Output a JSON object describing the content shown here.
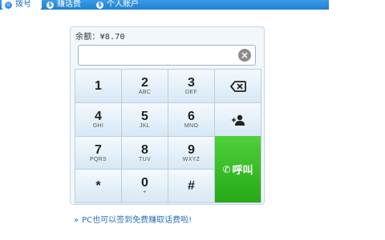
{
  "nav": {
    "items": [
      {
        "label": "拨号",
        "icon": "phone-icon",
        "active": true
      },
      {
        "label": "赚话费",
        "icon": "coin-icon",
        "active": false
      },
      {
        "label": "个人账户",
        "icon": "dollar-icon",
        "active": false
      }
    ],
    "accent": "#1f7fd2"
  },
  "balance_text": "余额：¥8.70",
  "dial_input": {
    "value": "",
    "placeholder": ""
  },
  "keys": [
    {
      "digit": "1",
      "letters": ""
    },
    {
      "digit": "2",
      "letters": "ABC"
    },
    {
      "digit": "3",
      "letters": "DEF"
    },
    {
      "digit": "4",
      "letters": "GHI"
    },
    {
      "digit": "5",
      "letters": "JKL"
    },
    {
      "digit": "6",
      "letters": "MNO"
    },
    {
      "digit": "7",
      "letters": "PQRS"
    },
    {
      "digit": "8",
      "letters": "TUV"
    },
    {
      "digit": "9",
      "letters": "WXYZ"
    },
    {
      "digit": "*",
      "letters": ""
    },
    {
      "digit": "0",
      "letters": "+"
    },
    {
      "digit": "#",
      "letters": ""
    }
  ],
  "backspace_icon": "backspace-icon",
  "contacts_icon": "add-contact-icon",
  "call_button": {
    "label": "呼叫",
    "color": "#33b923"
  },
  "promo_text": "PC也可以签到免费赚取话费啦!"
}
